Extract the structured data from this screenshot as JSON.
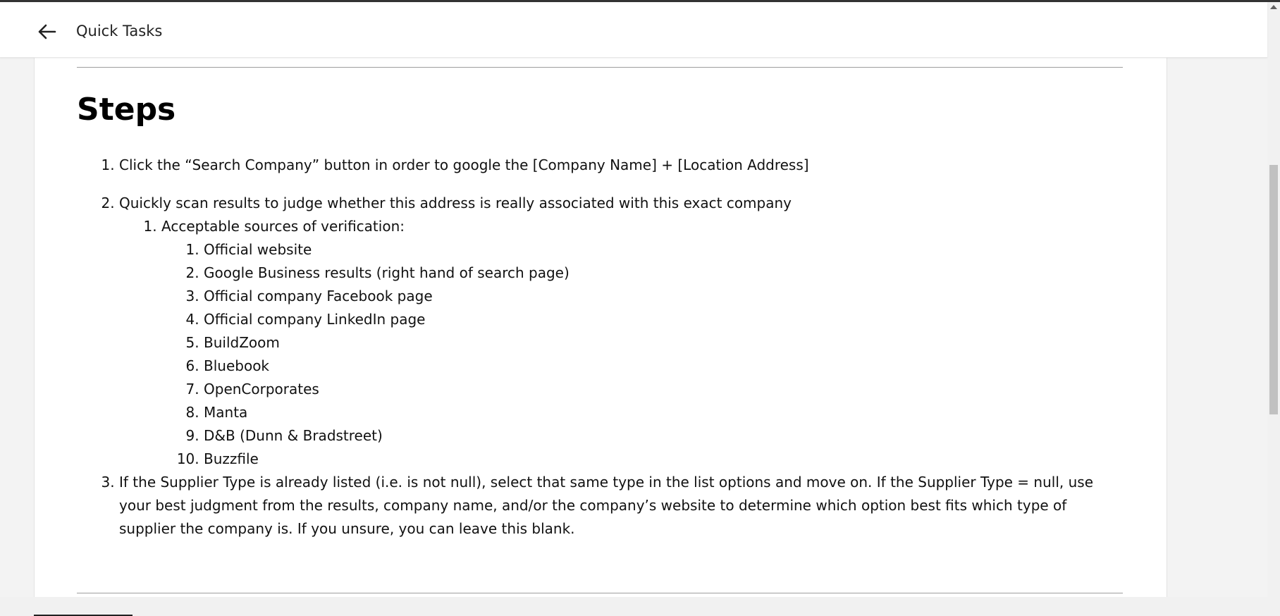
{
  "header": {
    "title": "Quick Tasks",
    "back_icon": "arrow-left-icon"
  },
  "content": {
    "heading": "Steps",
    "steps": [
      {
        "text": "Click the “Search Company” button in order to google the [Company Name] + [Location Address]"
      },
      {
        "text": "Quickly scan results to judge whether this address is really associated with this exact company",
        "sub": {
          "text": "Acceptable sources of verification:",
          "items": [
            "Official website",
            "Google Business results (right hand of search page)",
            "Official company Facebook page",
            "Official company LinkedIn page",
            "BuildZoom",
            "Bluebook",
            "OpenCorporates",
            "Manta",
            "D&B (Dunn & Bradstreet)",
            "Buzzfile"
          ]
        }
      },
      {
        "text": "If the Supplier Type is already listed (i.e. is not null), select that same type in the list options and move on. If the Supplier Type = null, use your best judgment from the results, company name, and/or the company’s website to determine which option best fits which type of supplier the company is. If you unsure, you can leave this blank."
      }
    ]
  }
}
